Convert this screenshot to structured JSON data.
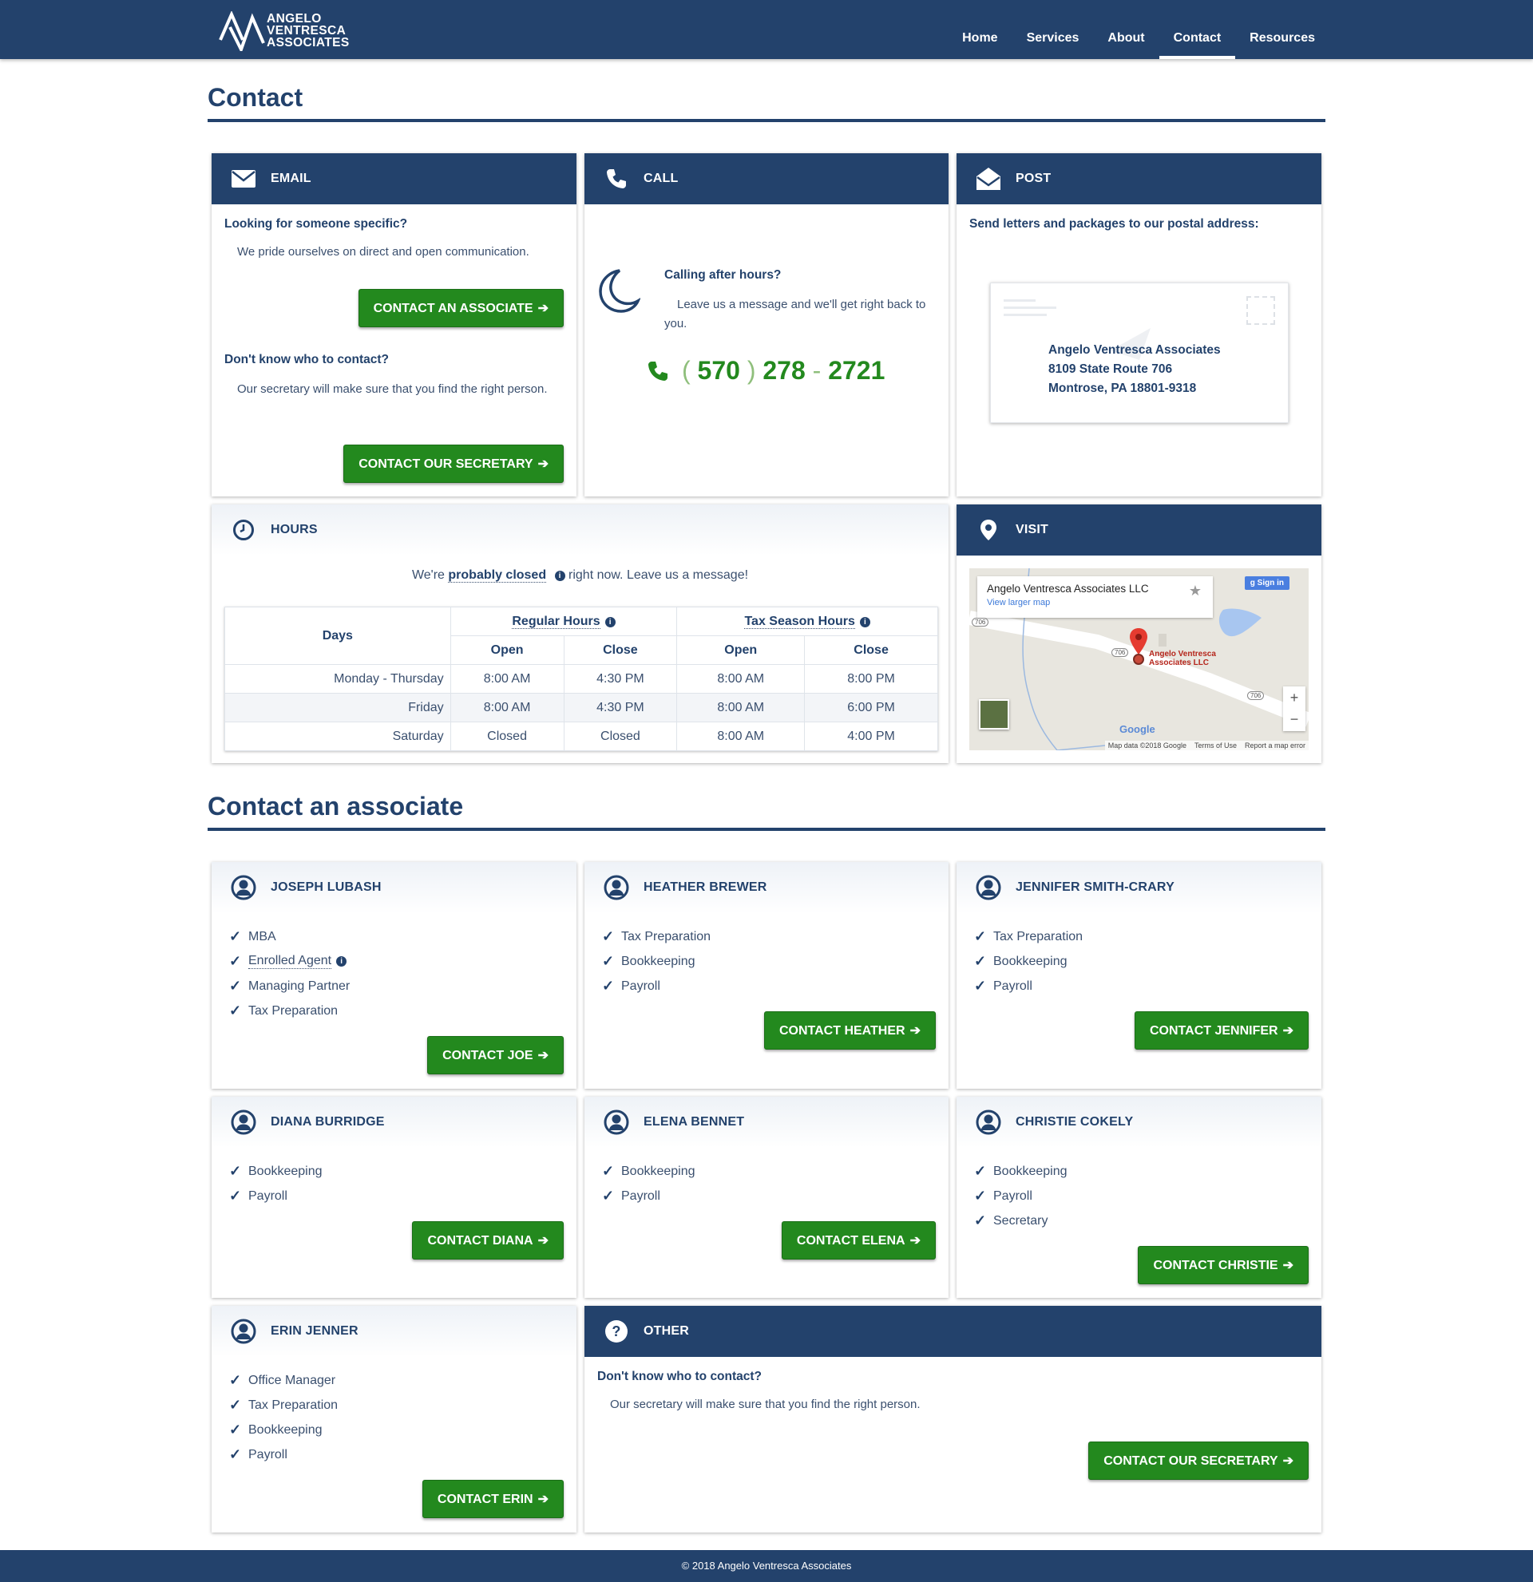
{
  "nav": {
    "logo_lines": [
      "ANGELO",
      "VENTRESCA",
      "ASSOCIATES"
    ],
    "links": [
      "Home",
      "Services",
      "About",
      "Contact",
      "Resources"
    ],
    "active": "Contact"
  },
  "contact_title": "Contact",
  "email": {
    "title": "EMAIL",
    "q1": "Looking for someone specific?",
    "p1": "We pride ourselves on direct and open communication.",
    "btn1": "CONTACT AN ASSOCIATE",
    "q2": "Don't know who to contact?",
    "p2": "Our secretary will make sure that you find the right person.",
    "btn2": "CONTACT OUR SECRETARY"
  },
  "call": {
    "title": "CALL",
    "q": "Calling after hours?",
    "p": "Leave us a message and we'll get right back to you.",
    "phone_area": "570",
    "phone_prefix": "278",
    "phone_line": "2721"
  },
  "post": {
    "title": "POST",
    "intro": "Send letters and packages to our postal address:",
    "address": [
      "Angelo Ventresca Associates",
      "8109 State Route 706",
      "Montrose, PA 18801-9318"
    ]
  },
  "hours": {
    "title": "HOURS",
    "status_pre": "We're",
    "status_word": "probably closed",
    "status_post": "right now. Leave us a message!",
    "days_header": "Days",
    "regular": "Regular Hours",
    "tax": "Tax Season Hours",
    "open": "Open",
    "close": "Close",
    "rows": [
      {
        "day": "Monday - Thursday",
        "r_open": "8:00 AM",
        "r_close": "4:30 PM",
        "t_open": "8:00 AM",
        "t_close": "8:00 PM"
      },
      {
        "day": "Friday",
        "r_open": "8:00 AM",
        "r_close": "4:30 PM",
        "t_open": "8:00 AM",
        "t_close": "6:00 PM"
      },
      {
        "day": "Saturday",
        "r_open": "Closed",
        "r_close": "Closed",
        "t_open": "8:00 AM",
        "t_close": "4:00 PM"
      }
    ]
  },
  "visit": {
    "title": "VISIT",
    "place": "Angelo Ventresca Associates LLC",
    "larger": "View larger map",
    "signin": "Sign in",
    "pin_label_1": "Angelo Ventresca",
    "pin_label_2": "Associates LLC",
    "route": "706",
    "google": "Google",
    "map_data": "Map data ©2018 Google",
    "terms": "Terms of Use",
    "report": "Report a map error"
  },
  "associates_title": "Contact an associate",
  "associates": [
    {
      "name": "JOSEPH LUBASH",
      "items": [
        "MBA",
        "Enrolled Agent",
        "Managing Partner",
        "Tax Preparation"
      ],
      "button": "CONTACT JOE"
    },
    {
      "name": "HEATHER BREWER",
      "items": [
        "Tax Preparation",
        "Bookkeeping",
        "Payroll"
      ],
      "button": "CONTACT HEATHER"
    },
    {
      "name": "JENNIFER SMITH-CRARY",
      "items": [
        "Tax Preparation",
        "Bookkeeping",
        "Payroll"
      ],
      "button": "CONTACT JENNIFER"
    },
    {
      "name": "DIANA BURRIDGE",
      "items": [
        "Bookkeeping",
        "Payroll"
      ],
      "button": "CONTACT DIANA"
    },
    {
      "name": "ELENA BENNET",
      "items": [
        "Bookkeeping",
        "Payroll"
      ],
      "button": "CONTACT ELENA"
    },
    {
      "name": "CHRISTIE COKELY",
      "items": [
        "Bookkeeping",
        "Payroll",
        "Secretary"
      ],
      "button": "CONTACT CHRISTIE"
    },
    {
      "name": "ERIN JENNER",
      "items": [
        "Office Manager",
        "Tax Preparation",
        "Bookkeeping",
        "Payroll"
      ],
      "button": "CONTACT ERIN"
    }
  ],
  "other": {
    "title": "OTHER",
    "q": "Don't know who to contact?",
    "p": "Our secretary will make sure that you find the right person.",
    "btn": "CONTACT OUR SECRETARY"
  },
  "footer": "© 2018 Angelo Ventresca Associates",
  "colors": {
    "navy": "#23426c",
    "green": "#23891e"
  }
}
